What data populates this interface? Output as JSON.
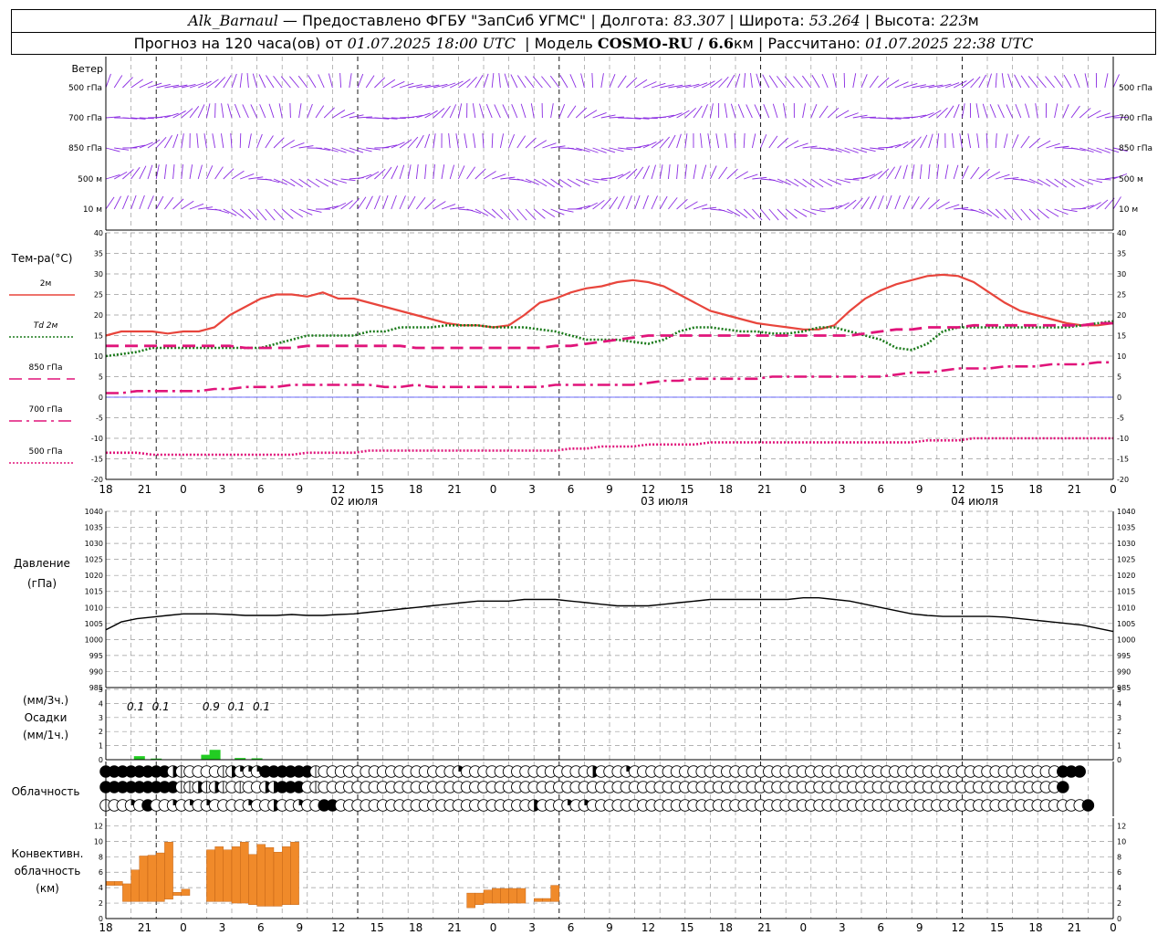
{
  "header": {
    "station": "Alk_Barnaul",
    "dash": "—",
    "provider": "Предоставлено ФГБУ \"ЗапСиб УГМС\"",
    "lon_label": "Долгота:",
    "lon": "83.307",
    "lat_label": "Широта:",
    "lat": "53.264",
    "alt_label": "Высота:",
    "alt": "223",
    "alt_unit": "м",
    "forecast_label": "Прогноз на 120 часа(ов) от",
    "forecast_start": "01.07.2025 18:00 UTC",
    "model_label": "Модель",
    "model": "COSMO-RU / 6.6",
    "model_unit": "км",
    "calc_label": "Рассчитано:",
    "calc_time": "01.07.2025 22:38 UTC"
  },
  "labels": {
    "wind": "Ветер",
    "wind_levels": [
      "500 гПа",
      "700 гПа",
      "850 гПа",
      "500 м",
      "10  м"
    ],
    "temp_title": "Тем-ра(°С)",
    "temp_legend": [
      "2м",
      "Td  2м",
      "850 гПа",
      "700 гПа",
      "500 гПа"
    ],
    "pressure_title": "Давление",
    "pressure_unit": "(гПа)",
    "precip_unit3": "(мм/3ч.)",
    "precip_title": "Осадки",
    "precip_unit1": "(мм/1ч.)",
    "cloud_title": "Облачность",
    "conv_title1": "Конвективн.",
    "conv_title2": "облачность",
    "conv_unit": "(км)"
  },
  "colors": {
    "t2m": "#e8453c",
    "td2m": "#1a7a1a",
    "t850": "#e0147a",
    "t700": "#e0147a",
    "t500": "#e0147a",
    "wind": "#8a2be2",
    "precip": "#22cc22",
    "conv": "#f08a2a",
    "zero_line": "#4040ff"
  },
  "chart_data": [
    {
      "type": "line",
      "name": "wind_barbs",
      "levels": [
        "500 гПа",
        "700 гПа",
        "850 гПа",
        "500 м",
        "10 м"
      ]
    },
    {
      "type": "line",
      "x_ticks": [
        "18",
        "21",
        "0",
        "3",
        "6",
        "9",
        "12",
        "15",
        "18",
        "21",
        "0",
        "3",
        "6",
        "9",
        "12",
        "15",
        "18",
        "21",
        "0",
        "3",
        "6",
        "9",
        "12",
        "15",
        "18",
        "21",
        "0"
      ],
      "day_labels": [
        "02 июля",
        "03 июля",
        "04 июля"
      ],
      "ylim": [
        -20,
        40
      ],
      "yticks": [
        -20,
        -15,
        -10,
        -5,
        0,
        5,
        10,
        15,
        20,
        25,
        30,
        35,
        40
      ],
      "series": [
        {
          "name": "2м",
          "style": "solid",
          "values": [
            15,
            16,
            16,
            16,
            15.5,
            16,
            16,
            17,
            20,
            22,
            24,
            25,
            25,
            24.5,
            25.5,
            24,
            24,
            23,
            22,
            21,
            20,
            19,
            18,
            17.5,
            17.5,
            17,
            17.5,
            20,
            23,
            24,
            25.5,
            26.5,
            27,
            28,
            28.5,
            28,
            27,
            25,
            23,
            21,
            20,
            19,
            18,
            17.5,
            17,
            16.5,
            16.5,
            17.5,
            21,
            24,
            26,
            27.5,
            28.5,
            29.5,
            29.8,
            29.5,
            28,
            25.5,
            23,
            21,
            20,
            19,
            18,
            17.5,
            17.5,
            18
          ]
        },
        {
          "name": "Td  2м",
          "style": "dotted",
          "values": [
            10,
            10.5,
            11,
            12,
            12,
            12,
            12,
            12,
            12,
            12,
            12,
            13,
            14,
            15,
            15,
            15,
            15,
            16,
            16,
            17,
            17,
            17,
            17.5,
            17.5,
            17.5,
            17,
            17,
            17,
            16.5,
            16,
            15,
            14,
            14,
            14,
            13.5,
            13,
            14,
            16,
            17,
            17,
            16.5,
            16,
            16,
            15.5,
            15.5,
            16,
            17,
            17,
            16,
            15,
            14,
            12,
            11.5,
            13,
            16,
            17,
            17,
            17,
            17,
            17,
            17,
            17,
            17,
            17.5,
            18,
            18.5
          ]
        },
        {
          "name": "850 гПа",
          "style": "dashed",
          "values": [
            12.5,
            12.5,
            12.5,
            12.5,
            12.5,
            12.5,
            12.5,
            12.5,
            12.5,
            12,
            12,
            12,
            12,
            12.5,
            12.5,
            12.5,
            12.5,
            12.5,
            12.5,
            12.5,
            12,
            12,
            12,
            12,
            12,
            12,
            12,
            12,
            12,
            12.5,
            12.5,
            13,
            13.5,
            14,
            14.5,
            15,
            15,
            15,
            15,
            15,
            15,
            15,
            15,
            15,
            15,
            15,
            15,
            15,
            15,
            15.5,
            16,
            16.5,
            16.5,
            17,
            17,
            17,
            17.5,
            17.5,
            17.5,
            17.5,
            17.5,
            17.5,
            17.5,
            17.5,
            18,
            18
          ]
        },
        {
          "name": "700 гПа",
          "style": "dashdot",
          "values": [
            1,
            1,
            1.5,
            1.5,
            1.5,
            1.5,
            1.5,
            2,
            2,
            2.5,
            2.5,
            2.5,
            3,
            3,
            3,
            3,
            3,
            3,
            2.5,
            2.5,
            3,
            2.5,
            2.5,
            2.5,
            2.5,
            2.5,
            2.5,
            2.5,
            2.5,
            3,
            3,
            3,
            3,
            3,
            3,
            3.5,
            4,
            4,
            4.5,
            4.5,
            4.5,
            4.5,
            4.5,
            5,
            5,
            5,
            5,
            5,
            5,
            5,
            5,
            5.5,
            6,
            6,
            6.5,
            7,
            7,
            7,
            7.5,
            7.5,
            7.5,
            8,
            8,
            8,
            8.5,
            8.5
          ]
        },
        {
          "name": "500 гПа",
          "style": "dotted",
          "values": [
            -13.5,
            -13.5,
            -13.5,
            -14,
            -14,
            -14,
            -14,
            -14,
            -14,
            -14,
            -14,
            -14,
            -14,
            -13.5,
            -13.5,
            -13.5,
            -13.5,
            -13,
            -13,
            -13,
            -13,
            -13,
            -13,
            -13,
            -13,
            -13,
            -13,
            -13,
            -13,
            -13,
            -12.5,
            -12.5,
            -12,
            -12,
            -12,
            -11.5,
            -11.5,
            -11.5,
            -11.5,
            -11,
            -11,
            -11,
            -11,
            -11,
            -11,
            -11,
            -11,
            -11,
            -11,
            -11,
            -11,
            -11,
            -11,
            -10.5,
            -10.5,
            -10.5,
            -10,
            -10,
            -10,
            -10,
            -10,
            -10,
            -10,
            -10,
            -10,
            -10
          ]
        }
      ]
    },
    {
      "type": "line",
      "ylim": [
        985,
        1040
      ],
      "yticks": [
        985,
        990,
        995,
        1000,
        1005,
        1010,
        1015,
        1020,
        1025,
        1030,
        1035,
        1040
      ],
      "series": [
        {
          "name": "",
          "values": [
            1003,
            1005.5,
            1006.5,
            1007,
            1007.5,
            1008,
            1008,
            1008,
            1007.8,
            1007.5,
            1007.5,
            1007.5,
            1007.8,
            1007.5,
            1007.5,
            1007.8,
            1008,
            1008.5,
            1009,
            1009.5,
            1010,
            1010.5,
            1011,
            1011.5,
            1012,
            1012,
            1012,
            1012.5,
            1012.5,
            1012.5,
            1012,
            1011.5,
            1011,
            1010.5,
            1010.5,
            1010.5,
            1011,
            1011.5,
            1012,
            1012.5,
            1012.5,
            1012.5,
            1012.5,
            1012.5,
            1012.5,
            1013,
            1013,
            1012.5,
            1012,
            1011,
            1010,
            1009,
            1008,
            1007.5,
            1007.2,
            1007.2,
            1007.2,
            1007.2,
            1007,
            1006.5,
            1006,
            1005.5,
            1005,
            1004.5,
            1003.5,
            1002.5
          ]
        }
      ]
    },
    {
      "type": "bar",
      "ylim": [
        0,
        5
      ],
      "yticks": [
        0,
        1,
        2,
        3,
        4,
        5
      ],
      "labels": [
        {
          "hour": 3,
          "text": "0.1"
        },
        {
          "hour": 6,
          "text": "0.1"
        },
        {
          "hour": 12,
          "text": "0.9"
        },
        {
          "hour": 15,
          "text": "0.1"
        },
        {
          "hour": 18,
          "text": "0.1"
        }
      ],
      "bars": [
        {
          "hour": 4,
          "value": 0.25
        },
        {
          "hour": 6,
          "value": 0.08
        },
        {
          "hour": 12,
          "value": 0.35
        },
        {
          "hour": 13,
          "value": 0.7
        },
        {
          "hour": 16,
          "value": 0.12
        },
        {
          "hour": 18,
          "value": 0.1
        }
      ]
    },
    {
      "type": "table",
      "name": "cloud_cover",
      "rows": [
        "888888885o0000o4233888888o0000000000000000200000000000000040003000000000000000000000000000000000000000000000000000888",
        "888888888oo5e4o0o00548880o00000000000000000000000000000000000000000000000000000000000000000000000000000000000000008",
        "0006080060606000060040060088000000000000000000000004000306000000000000000000000000000000000000000000000000000000000008"
      ]
    },
    {
      "type": "bar",
      "ylim": [
        0,
        13
      ],
      "yticks": [
        0,
        2,
        4,
        6,
        8,
        10,
        12
      ],
      "bars": [
        {
          "h0": 0,
          "h1": 1,
          "base": 4.3,
          "top": 4.8
        },
        {
          "h0": 1,
          "h1": 2,
          "base": 4.3,
          "top": 4.8
        },
        {
          "h0": 2,
          "h1": 3,
          "base": 2.2,
          "top": 4.5
        },
        {
          "h0": 3,
          "h1": 4,
          "base": 2.2,
          "top": 6.3
        },
        {
          "h0": 4,
          "h1": 5,
          "base": 2.2,
          "top": 8.1
        },
        {
          "h0": 5,
          "h1": 6,
          "base": 2.2,
          "top": 8.2
        },
        {
          "h0": 6,
          "h1": 7,
          "base": 2.2,
          "top": 8.5
        },
        {
          "h0": 7,
          "h1": 8,
          "base": 2.5,
          "top": 9.9
        },
        {
          "h0": 8,
          "h1": 9,
          "base": 3.0,
          "top": 3.4
        },
        {
          "h0": 9,
          "h1": 10,
          "base": 3.0,
          "top": 3.8
        },
        {
          "h0": 12,
          "h1": 13,
          "base": 2.2,
          "top": 8.9
        },
        {
          "h0": 13,
          "h1": 14,
          "base": 2.2,
          "top": 9.3
        },
        {
          "h0": 14,
          "h1": 15,
          "base": 2.2,
          "top": 8.9
        },
        {
          "h0": 15,
          "h1": 16,
          "base": 2.0,
          "top": 9.3
        },
        {
          "h0": 16,
          "h1": 17,
          "base": 2.0,
          "top": 9.9
        },
        {
          "h0": 17,
          "h1": 18,
          "base": 1.8,
          "top": 8.3
        },
        {
          "h0": 18,
          "h1": 19,
          "base": 1.6,
          "top": 9.6
        },
        {
          "h0": 19,
          "h1": 20,
          "base": 1.6,
          "top": 9.2
        },
        {
          "h0": 20,
          "h1": 21,
          "base": 1.6,
          "top": 8.6
        },
        {
          "h0": 21,
          "h1": 22,
          "base": 1.8,
          "top": 9.3
        },
        {
          "h0": 22,
          "h1": 23,
          "base": 1.8,
          "top": 9.9
        },
        {
          "h0": 43,
          "h1": 44,
          "base": 1.4,
          "top": 3.3
        },
        {
          "h0": 44,
          "h1": 45,
          "base": 1.8,
          "top": 3.3
        },
        {
          "h0": 45,
          "h1": 46,
          "base": 2.0,
          "top": 3.7
        },
        {
          "h0": 46,
          "h1": 47,
          "base": 2.0,
          "top": 3.9
        },
        {
          "h0": 47,
          "h1": 48,
          "base": 2.0,
          "top": 3.9
        },
        {
          "h0": 48,
          "h1": 49,
          "base": 2.0,
          "top": 3.9
        },
        {
          "h0": 49,
          "h1": 50,
          "base": 2.0,
          "top": 3.9
        },
        {
          "h0": 51,
          "h1": 52,
          "base": 2.2,
          "top": 2.6
        },
        {
          "h0": 52,
          "h1": 53,
          "base": 2.2,
          "top": 2.6
        },
        {
          "h0": 53,
          "h1": 54,
          "base": 2.2,
          "top": 4.3
        }
      ]
    }
  ]
}
